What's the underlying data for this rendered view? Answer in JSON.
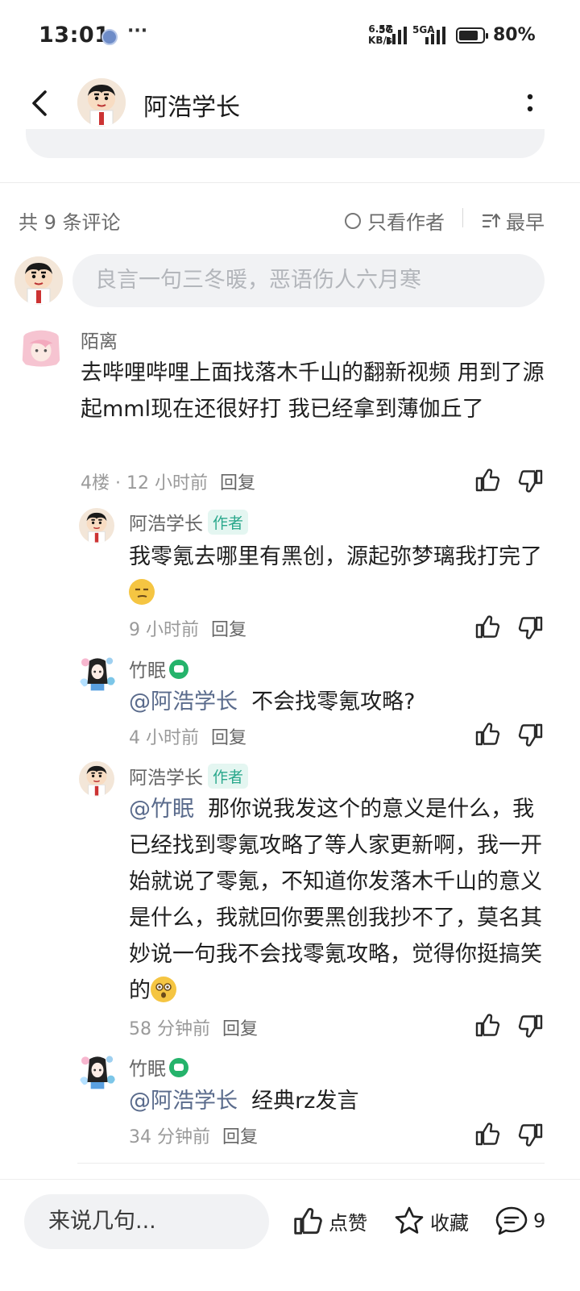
{
  "status": {
    "time": "13:01",
    "net_speed_value": "6.57",
    "net_speed_unit": "KB/s",
    "sim1_label": "5G",
    "sim2_label": "5GA",
    "battery": "80%",
    "battery_level": 0.8
  },
  "header": {
    "title": "阿浩学长"
  },
  "comments_header": {
    "count": "共 9 条评论",
    "author_only": "只看作者",
    "sort": "最早"
  },
  "comment_input": {
    "placeholder": "良言一句三冬暖，恶语伤人六月寒"
  },
  "comments": [
    {
      "name": "陌离",
      "text": "去哔哩哔哩上面找落木千山的翻新视频 用到了源起mml现在还很好打  我已经拿到薄伽丘了",
      "floor": "4楼",
      "dot": "·",
      "time": "12 小时前",
      "reply": "回复"
    }
  ],
  "replies": [
    {
      "name": "阿浩学长",
      "tag": "作者",
      "text": "我零氪去哪里有黑创，源起弥梦璃我打完了",
      "time": "9 小时前",
      "reply": "回复"
    },
    {
      "name": "竹眠",
      "mention": "@阿浩学长",
      "text": "不会找零氪攻略?",
      "time": "4 小时前",
      "reply": "回复"
    },
    {
      "name": "阿浩学长",
      "tag": "作者",
      "mention": "@竹眠",
      "text_line1": "那你说我发这个的意义是什",
      "text_rest": "么，我已经找到零氪攻略了等人家更新啊，我一开始就说了零氪，不知道你发落木千山的意义是什么，我就回你要黑创我抄不了，莫名其妙说一句我不会找零氪攻略，觉得你挺搞笑的",
      "time": "58 分钟前",
      "reply": "回复"
    },
    {
      "name": "竹眠",
      "mention": "@阿浩学长",
      "text": "经典rz发言",
      "time": "34 分钟前",
      "reply": "回复"
    }
  ],
  "bottom_bar": {
    "input_placeholder": "来说几句...",
    "like_label": "点赞",
    "favorite_label": "收藏",
    "comment_count": "9"
  },
  "colors": {
    "author_tag": "#2aa88c",
    "author_tag_bg": "#e4f6f1",
    "game_badge": "#25b36b",
    "input_bg": "#f1f2f4"
  }
}
